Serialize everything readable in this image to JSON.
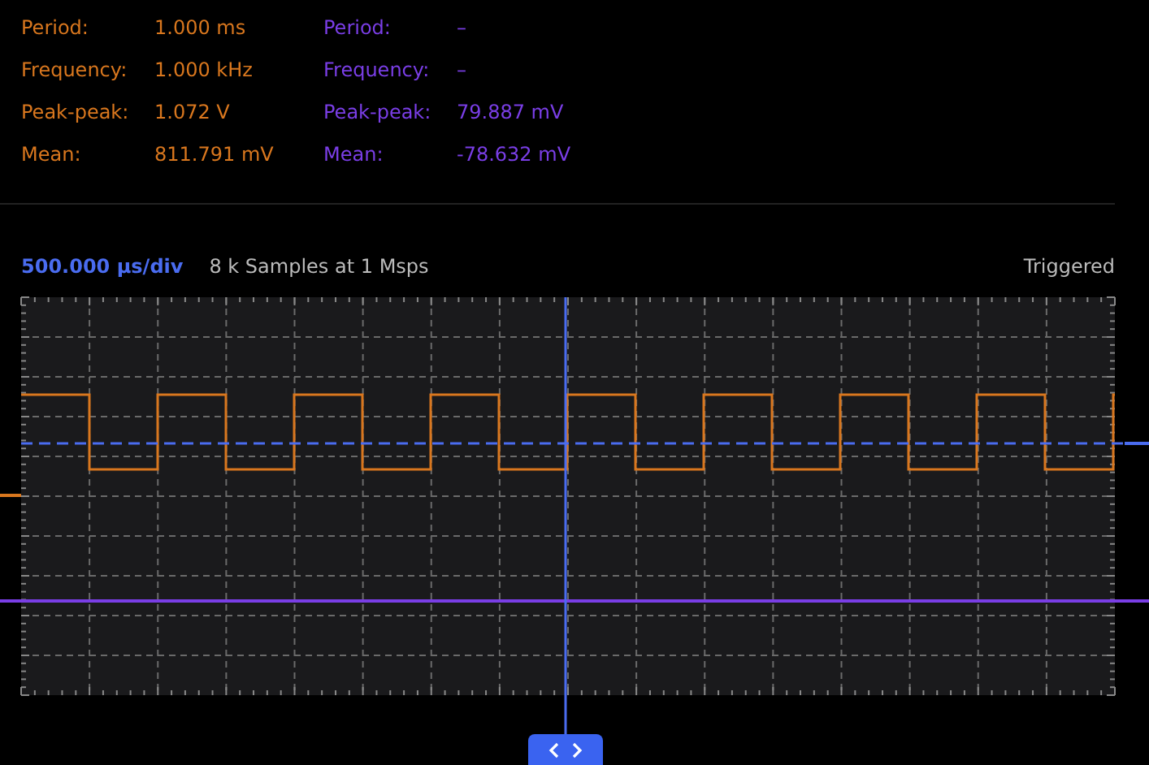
{
  "measurements": [
    {
      "color": "#d9771e",
      "rows": [
        {
          "label": "Period:",
          "value": "1.000 ms"
        },
        {
          "label": "Frequency:",
          "value": "1.000 kHz"
        },
        {
          "label": "Peak-peak:",
          "value": "1.072 V"
        },
        {
          "label": "Mean:",
          "value": "811.791 mV"
        }
      ]
    },
    {
      "color": "#7a3ee6",
      "rows": [
        {
          "label": "Period:",
          "value": "–"
        },
        {
          "label": "Frequency:",
          "value": "–"
        },
        {
          "label": "Peak-peak:",
          "value": "79.887 mV"
        },
        {
          "label": "Mean:",
          "value": "-78.632 mV"
        }
      ]
    }
  ],
  "scope": {
    "timebase": "500.000 µs/div",
    "samples": "8 k Samples at 1 Msps",
    "status": "Triggered"
  }
}
